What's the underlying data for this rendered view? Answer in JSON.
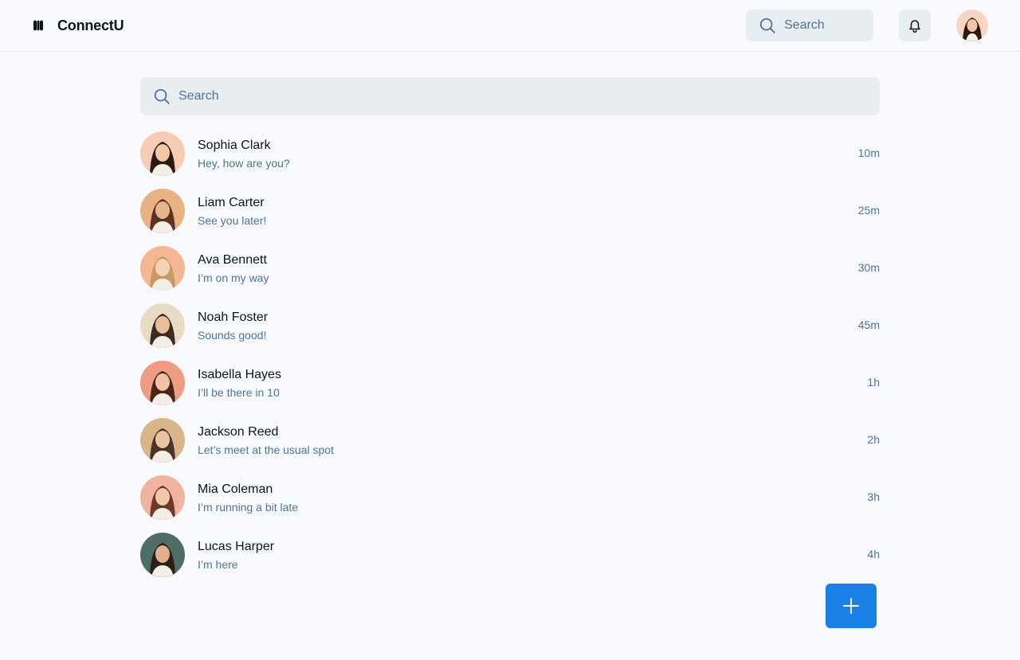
{
  "header": {
    "brand_name": "ConnectU",
    "search_placeholder": "Search"
  },
  "main": {
    "search_placeholder": "Search"
  },
  "chats": [
    {
      "name": "Sophia Clark",
      "message": "Hey, how are you?",
      "time": "10m",
      "avatar_bg": "#f6cdb4",
      "hair": "#2a1a14",
      "skin": "#f2c7a7"
    },
    {
      "name": "Liam Carter",
      "message": "See you later!",
      "time": "25m",
      "avatar_bg": "#e9b184",
      "hair": "#5a3420",
      "skin": "#e6b48e"
    },
    {
      "name": "Ava Bennett",
      "message": "I’m on my way",
      "time": "30m",
      "avatar_bg": "#f3b793",
      "hair": "#c89a68",
      "skin": "#f5d2b4"
    },
    {
      "name": "Noah Foster",
      "message": "Sounds good!",
      "time": "45m",
      "avatar_bg": "#e8dcc6",
      "hair": "#3c2a20",
      "skin": "#e8bf9c"
    },
    {
      "name": "Isabella Hayes",
      "message": "I’ll be there in 10",
      "time": "1h",
      "avatar_bg": "#f09c84",
      "hair": "#4a2418",
      "skin": "#f1c2a4"
    },
    {
      "name": "Jackson Reed",
      "message": "Let’s meet at the usual spot",
      "time": "2h",
      "avatar_bg": "#d9b58c",
      "hair": "#4b3224",
      "skin": "#eac3a2"
    },
    {
      "name": "Mia Coleman",
      "message": "I’m running a bit late",
      "time": "3h",
      "avatar_bg": "#efb3a0",
      "hair": "#6a3a26",
      "skin": "#f2c8ad"
    },
    {
      "name": "Lucas Harper",
      "message": "I’m here",
      "time": "4h",
      "avatar_bg": "#4d6d66",
      "hair": "#2c1e17",
      "skin": "#e1b18e"
    }
  ],
  "colors": {
    "accent": "#1a80e5",
    "muted_text": "#4f7396",
    "field_bg": "#e8edf2"
  },
  "icons": {
    "brand": "logo-icon",
    "search": "search-icon",
    "notifications": "bell-icon",
    "new_chat": "plus-icon"
  }
}
